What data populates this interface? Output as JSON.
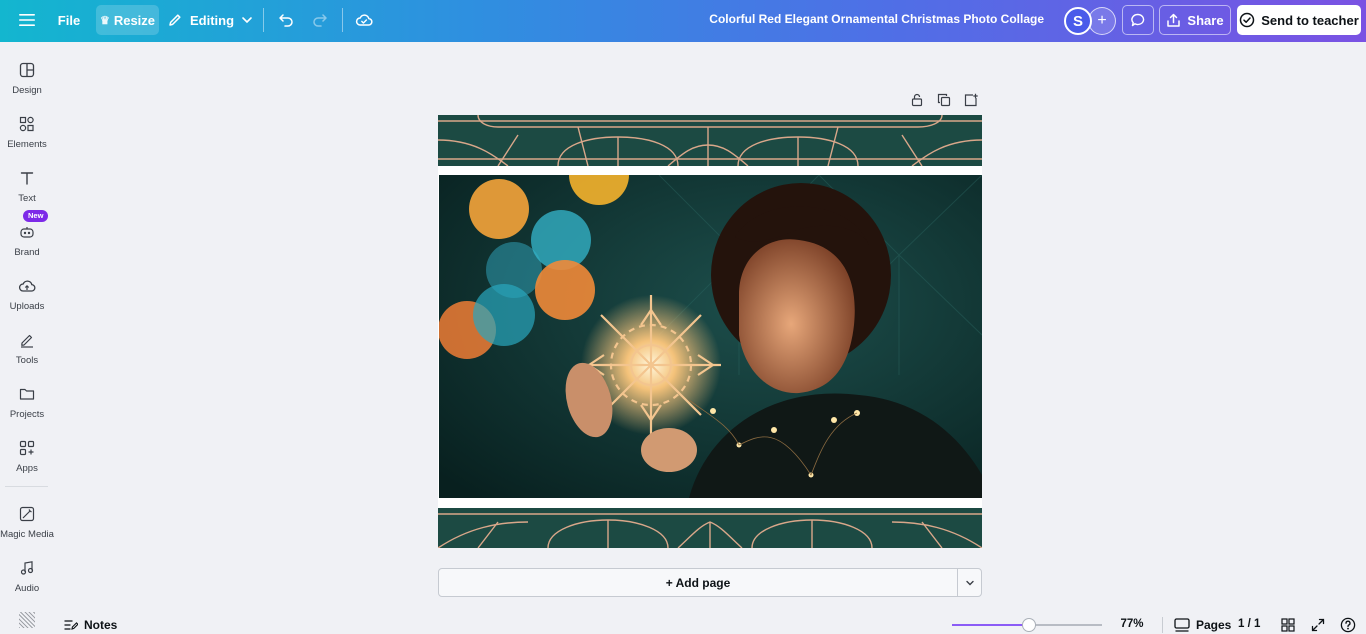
{
  "topbar": {
    "file_label": "File",
    "resize_label": "Resize",
    "editing_label": "Editing",
    "document_title": "Colorful Red Elegant Ornamental Christmas Photo Collage",
    "avatar_initial": "S",
    "share_label": "Share",
    "send_label": "Send to teacher",
    "gradient_colors": [
      "#13b6cf",
      "#2f8fe0",
      "#4f6fe6",
      "#7a52e3"
    ]
  },
  "sidebar": {
    "items": [
      {
        "label": "Design",
        "icon": "design-icon"
      },
      {
        "label": "Elements",
        "icon": "elements-icon"
      },
      {
        "label": "Text",
        "icon": "text-icon"
      },
      {
        "label": "Brand",
        "icon": "brand-icon"
      },
      {
        "label": "Uploads",
        "icon": "uploads-icon"
      },
      {
        "label": "Tools",
        "icon": "tools-icon"
      },
      {
        "label": "Projects",
        "icon": "projects-icon"
      },
      {
        "label": "Apps",
        "icon": "apps-icon"
      },
      {
        "label": "Magic Media",
        "icon": "magic-media-icon"
      },
      {
        "label": "Audio",
        "icon": "audio-icon"
      }
    ],
    "new_badge": "New"
  },
  "canvas": {
    "band_color": "#1c4a43",
    "ornament_color": "#d9a78a",
    "photo_description_icon": "photo-image"
  },
  "add_page": {
    "label": "+ Add page"
  },
  "bottombar": {
    "notes_label": "Notes",
    "zoom_label": "77%",
    "zoom_fraction": 0.51,
    "pages_label": "Pages",
    "page_count": "1 / 1"
  }
}
